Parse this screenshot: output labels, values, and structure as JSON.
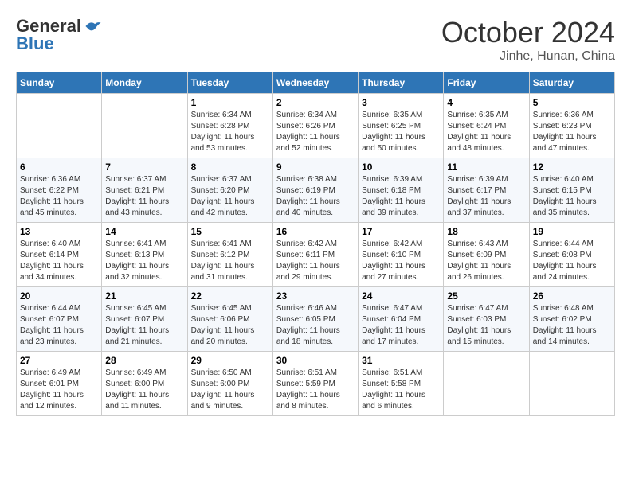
{
  "header": {
    "logo_general": "General",
    "logo_blue": "Blue",
    "month_title": "October 2024",
    "location": "Jinhe, Hunan, China"
  },
  "weekdays": [
    "Sunday",
    "Monday",
    "Tuesday",
    "Wednesday",
    "Thursday",
    "Friday",
    "Saturday"
  ],
  "weeks": [
    [
      {
        "day": "",
        "info": ""
      },
      {
        "day": "",
        "info": ""
      },
      {
        "day": "1",
        "info": "Sunrise: 6:34 AM\nSunset: 6:28 PM\nDaylight: 11 hours and 53 minutes."
      },
      {
        "day": "2",
        "info": "Sunrise: 6:34 AM\nSunset: 6:26 PM\nDaylight: 11 hours and 52 minutes."
      },
      {
        "day": "3",
        "info": "Sunrise: 6:35 AM\nSunset: 6:25 PM\nDaylight: 11 hours and 50 minutes."
      },
      {
        "day": "4",
        "info": "Sunrise: 6:35 AM\nSunset: 6:24 PM\nDaylight: 11 hours and 48 minutes."
      },
      {
        "day": "5",
        "info": "Sunrise: 6:36 AM\nSunset: 6:23 PM\nDaylight: 11 hours and 47 minutes."
      }
    ],
    [
      {
        "day": "6",
        "info": "Sunrise: 6:36 AM\nSunset: 6:22 PM\nDaylight: 11 hours and 45 minutes."
      },
      {
        "day": "7",
        "info": "Sunrise: 6:37 AM\nSunset: 6:21 PM\nDaylight: 11 hours and 43 minutes."
      },
      {
        "day": "8",
        "info": "Sunrise: 6:37 AM\nSunset: 6:20 PM\nDaylight: 11 hours and 42 minutes."
      },
      {
        "day": "9",
        "info": "Sunrise: 6:38 AM\nSunset: 6:19 PM\nDaylight: 11 hours and 40 minutes."
      },
      {
        "day": "10",
        "info": "Sunrise: 6:39 AM\nSunset: 6:18 PM\nDaylight: 11 hours and 39 minutes."
      },
      {
        "day": "11",
        "info": "Sunrise: 6:39 AM\nSunset: 6:17 PM\nDaylight: 11 hours and 37 minutes."
      },
      {
        "day": "12",
        "info": "Sunrise: 6:40 AM\nSunset: 6:15 PM\nDaylight: 11 hours and 35 minutes."
      }
    ],
    [
      {
        "day": "13",
        "info": "Sunrise: 6:40 AM\nSunset: 6:14 PM\nDaylight: 11 hours and 34 minutes."
      },
      {
        "day": "14",
        "info": "Sunrise: 6:41 AM\nSunset: 6:13 PM\nDaylight: 11 hours and 32 minutes."
      },
      {
        "day": "15",
        "info": "Sunrise: 6:41 AM\nSunset: 6:12 PM\nDaylight: 11 hours and 31 minutes."
      },
      {
        "day": "16",
        "info": "Sunrise: 6:42 AM\nSunset: 6:11 PM\nDaylight: 11 hours and 29 minutes."
      },
      {
        "day": "17",
        "info": "Sunrise: 6:42 AM\nSunset: 6:10 PM\nDaylight: 11 hours and 27 minutes."
      },
      {
        "day": "18",
        "info": "Sunrise: 6:43 AM\nSunset: 6:09 PM\nDaylight: 11 hours and 26 minutes."
      },
      {
        "day": "19",
        "info": "Sunrise: 6:44 AM\nSunset: 6:08 PM\nDaylight: 11 hours and 24 minutes."
      }
    ],
    [
      {
        "day": "20",
        "info": "Sunrise: 6:44 AM\nSunset: 6:07 PM\nDaylight: 11 hours and 23 minutes."
      },
      {
        "day": "21",
        "info": "Sunrise: 6:45 AM\nSunset: 6:07 PM\nDaylight: 11 hours and 21 minutes."
      },
      {
        "day": "22",
        "info": "Sunrise: 6:45 AM\nSunset: 6:06 PM\nDaylight: 11 hours and 20 minutes."
      },
      {
        "day": "23",
        "info": "Sunrise: 6:46 AM\nSunset: 6:05 PM\nDaylight: 11 hours and 18 minutes."
      },
      {
        "day": "24",
        "info": "Sunrise: 6:47 AM\nSunset: 6:04 PM\nDaylight: 11 hours and 17 minutes."
      },
      {
        "day": "25",
        "info": "Sunrise: 6:47 AM\nSunset: 6:03 PM\nDaylight: 11 hours and 15 minutes."
      },
      {
        "day": "26",
        "info": "Sunrise: 6:48 AM\nSunset: 6:02 PM\nDaylight: 11 hours and 14 minutes."
      }
    ],
    [
      {
        "day": "27",
        "info": "Sunrise: 6:49 AM\nSunset: 6:01 PM\nDaylight: 11 hours and 12 minutes."
      },
      {
        "day": "28",
        "info": "Sunrise: 6:49 AM\nSunset: 6:00 PM\nDaylight: 11 hours and 11 minutes."
      },
      {
        "day": "29",
        "info": "Sunrise: 6:50 AM\nSunset: 6:00 PM\nDaylight: 11 hours and 9 minutes."
      },
      {
        "day": "30",
        "info": "Sunrise: 6:51 AM\nSunset: 5:59 PM\nDaylight: 11 hours and 8 minutes."
      },
      {
        "day": "31",
        "info": "Sunrise: 6:51 AM\nSunset: 5:58 PM\nDaylight: 11 hours and 6 minutes."
      },
      {
        "day": "",
        "info": ""
      },
      {
        "day": "",
        "info": ""
      }
    ]
  ]
}
